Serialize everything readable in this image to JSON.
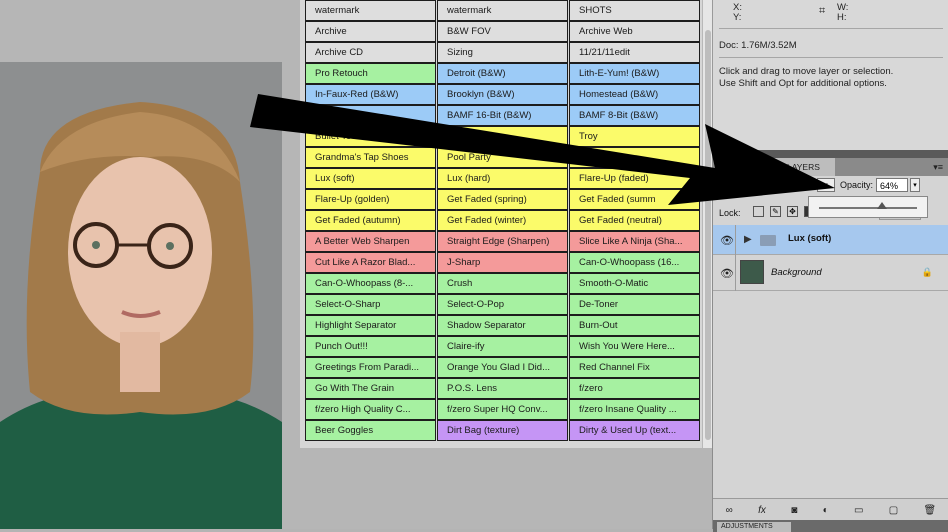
{
  "actions": {
    "rows": [
      [
        {
          "t": "watermark",
          "c": "gray"
        },
        {
          "t": "watermark",
          "c": "gray"
        },
        {
          "t": "SHOTS",
          "c": "gray"
        }
      ],
      [
        {
          "t": "Archive",
          "c": "gray"
        },
        {
          "t": "B&W FOV",
          "c": "gray"
        },
        {
          "t": "Archive Web",
          "c": "gray"
        }
      ],
      [
        {
          "t": "Archive CD",
          "c": "gray"
        },
        {
          "t": "Sizing",
          "c": "gray"
        },
        {
          "t": "11/21/11edit",
          "c": "gray"
        }
      ],
      [
        {
          "t": "Pro Retouch",
          "c": "green"
        },
        {
          "t": "Detroit (B&W)",
          "c": "blue"
        },
        {
          "t": "Lith-E-Yum! (B&W)",
          "c": "blue"
        }
      ],
      [
        {
          "t": "In-Faux-Red (B&W)",
          "c": "blue"
        },
        {
          "t": "Brooklyn (B&W)",
          "c": "blue"
        },
        {
          "t": "Homestead (B&W)",
          "c": "blue"
        }
      ],
      [
        {
          "t": "(B&W)",
          "c": "blue"
        },
        {
          "t": "BAMF 16-Bit (B&W)",
          "c": "blue"
        },
        {
          "t": "BAMF 8-Bit (B&W)",
          "c": "blue"
        }
      ],
      [
        {
          "t": "Bullet Tooth",
          "c": "yellow"
        },
        {
          "t": "",
          "c": "yellow"
        },
        {
          "t": "Troy",
          "c": "yellow"
        }
      ],
      [
        {
          "t": "Grandma's Tap Shoes",
          "c": "yellow"
        },
        {
          "t": "Pool Party",
          "c": "yellow"
        },
        {
          "t": "",
          "c": "yellow"
        }
      ],
      [
        {
          "t": "Lux (soft)",
          "c": "yellow"
        },
        {
          "t": "Lux (hard)",
          "c": "yellow"
        },
        {
          "t": "Flare-Up (faded)",
          "c": "yellow"
        }
      ],
      [
        {
          "t": "Flare-Up (golden)",
          "c": "yellow"
        },
        {
          "t": "Get Faded (spring)",
          "c": "yellow"
        },
        {
          "t": "Get Faded (summ",
          "c": "yellow"
        }
      ],
      [
        {
          "t": "Get Faded (autumn)",
          "c": "yellow"
        },
        {
          "t": "Get Faded (winter)",
          "c": "yellow"
        },
        {
          "t": "Get Faded (neutral)",
          "c": "yellow"
        }
      ],
      [
        {
          "t": "A Better Web Sharpen",
          "c": "red"
        },
        {
          "t": "Straight Edge (Sharpen)",
          "c": "red"
        },
        {
          "t": "Slice Like A Ninja (Sha...",
          "c": "red"
        }
      ],
      [
        {
          "t": "Cut Like A Razor Blad...",
          "c": "red"
        },
        {
          "t": "J-Sharp",
          "c": "red"
        },
        {
          "t": "Can-O-Whoopass (16...",
          "c": "green"
        }
      ],
      [
        {
          "t": "Can-O-Whoopass (8-...",
          "c": "green"
        },
        {
          "t": "Crush",
          "c": "green"
        },
        {
          "t": "Smooth-O-Matic",
          "c": "green"
        }
      ],
      [
        {
          "t": "Select-O-Sharp",
          "c": "green"
        },
        {
          "t": "Select-O-Pop",
          "c": "green"
        },
        {
          "t": "De-Toner",
          "c": "green"
        }
      ],
      [
        {
          "t": "Highlight Separator",
          "c": "green"
        },
        {
          "t": "Shadow Separator",
          "c": "green"
        },
        {
          "t": "Burn-Out",
          "c": "green"
        }
      ],
      [
        {
          "t": "Punch Out!!!",
          "c": "green"
        },
        {
          "t": "Claire-ify",
          "c": "green"
        },
        {
          "t": "Wish You Were Here...",
          "c": "green"
        }
      ],
      [
        {
          "t": "Greetings From Paradi...",
          "c": "green"
        },
        {
          "t": "Orange You Glad I Did...",
          "c": "green"
        },
        {
          "t": "Red Channel Fix",
          "c": "green"
        }
      ],
      [
        {
          "t": "Go With The Grain",
          "c": "green"
        },
        {
          "t": "P.O.S. Lens",
          "c": "green"
        },
        {
          "t": "f/zero",
          "c": "green"
        }
      ],
      [
        {
          "t": "f/zero High Quality C...",
          "c": "green"
        },
        {
          "t": "f/zero Super HQ Conv...",
          "c": "green"
        },
        {
          "t": "f/zero Insane Quality ...",
          "c": "green"
        }
      ],
      [
        {
          "t": "Beer Goggles",
          "c": "green"
        },
        {
          "t": "Dirt Bag (texture)",
          "c": "purple"
        },
        {
          "t": "Dirty & Used Up (text...",
          "c": "purple"
        }
      ]
    ]
  },
  "info": {
    "x_label": "X:",
    "y_label": "Y:",
    "w_label": "W:",
    "h_label": "H:",
    "doc": "Doc: 1.76M/3.52M",
    "hint_line1": "Click and drag to move layer or selection.",
    "hint_line2": "Use Shift and Opt for additional options."
  },
  "layers": {
    "tab_label": "LAYERS",
    "opacity_label": "Opacity:",
    "opacity_value": "64%",
    "opacity_fraction": 0.64,
    "lock_label": "Lock:",
    "items": [
      {
        "name": "Lux (soft)",
        "type": "group",
        "selected": true
      },
      {
        "name": "Background",
        "type": "pixel",
        "selected": false,
        "locked": true
      }
    ],
    "adjustments_tab": "ADJUSTMENTS"
  },
  "colors": {
    "gray": "#dedede",
    "green": "#a6f1a1",
    "blue": "#9ccbf7",
    "yellow": "#fbfb6a",
    "red": "#f49a9a",
    "purple": "#c595f5"
  }
}
